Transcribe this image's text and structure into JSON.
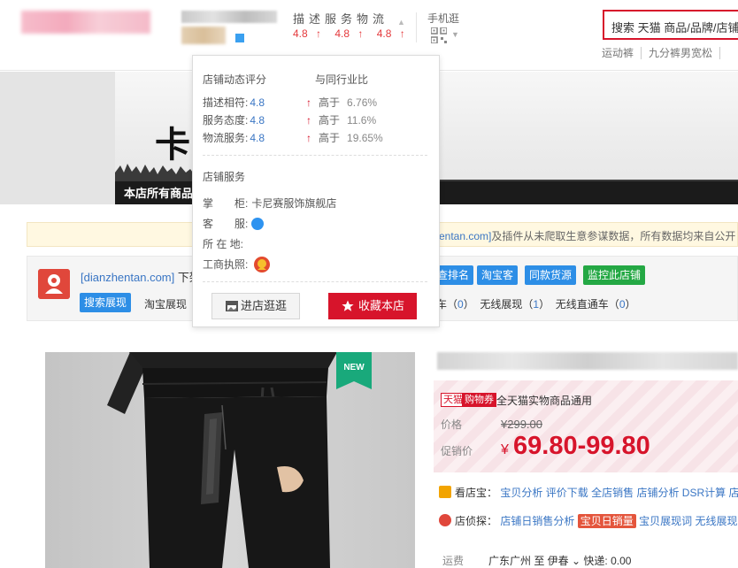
{
  "header": {
    "dsr_heading": "描述服务物流",
    "dsr_scores": [
      "4.8",
      "4.8",
      "4.8"
    ],
    "mobile_label": "手机逛",
    "search_text": "搜索 天猫 商品/品牌/店铺",
    "hot_links": [
      "运动裤",
      "九分裤男宽松"
    ]
  },
  "banner": {
    "title": "卡尼",
    "caption": "本店所有商品"
  },
  "notice": {
    "domain": "entan.com]",
    "text": "及插件从未爬取生意参谋数据，所有数据均来自公开"
  },
  "plugin": {
    "site": "[dianzhentan.com]",
    "site_rest": " 下架",
    "buttons": [
      "查排名",
      "淘宝客",
      "同款货源",
      "监控此店铺"
    ],
    "search_show": "搜索展现",
    "exposure_label": "淘宝展现（",
    "exposure_right": [
      {
        "label": "车",
        "value": "0"
      },
      {
        "label": "无线展现",
        "value": "1"
      },
      {
        "label": "无线直通车",
        "value": "0"
      }
    ]
  },
  "product": {
    "new_badge": "NEW",
    "tag_tmall": "天猫",
    "tag_coupon": "购物券",
    "promo_text": "全天猫实物商品通用",
    "price_label": "价格",
    "price_old": "¥299.00",
    "sale_label": "促销价",
    "sale_currency": "¥",
    "sale_price": "69.80-99.80",
    "kan_label": "看店宝：",
    "kan_links": [
      "宝贝分析",
      "评价下载",
      "全店销售",
      "店铺分析",
      "DSR计算",
      "店"
    ],
    "zhen_label": "店侦探：",
    "zhen_links": [
      "店铺日销售分析"
    ],
    "zhen_hot": "宝贝日销量",
    "zhen_links_after": [
      "宝贝展现词",
      "无线展现"
    ],
    "shipping_label": "运费",
    "shipping_text": "广东广州 至 伊春",
    "shipping_fee": "快递: 0.00"
  },
  "popup": {
    "heading_left": "店铺动态评分",
    "heading_right": "与同行业比",
    "rows": [
      {
        "label": "描述相符:",
        "value": "4.8",
        "compare": "高于",
        "pct": "6.76%"
      },
      {
        "label": "服务态度:",
        "value": "4.8",
        "compare": "高于",
        "pct": "11.6%"
      },
      {
        "label": "物流服务:",
        "value": "4.8",
        "compare": "高于",
        "pct": "19.65%"
      }
    ],
    "service_heading": "店铺服务",
    "shopkeeper_label": "掌　　柜:",
    "shopkeeper_value": "卡尼赛服饰旗舰店",
    "cs_label": "客　　服:",
    "location_label": "所 在 地:",
    "license_label": "工商执照:",
    "btn_visit": "进店逛逛",
    "btn_fav": "收藏本店"
  },
  "colors": {
    "tmall_red": "#d7142b",
    "link_blue": "#3a76c4",
    "plugin_blue": "#2d8ee6",
    "plugin_green": "#24a844",
    "new_badge_green": "#19a97b"
  }
}
